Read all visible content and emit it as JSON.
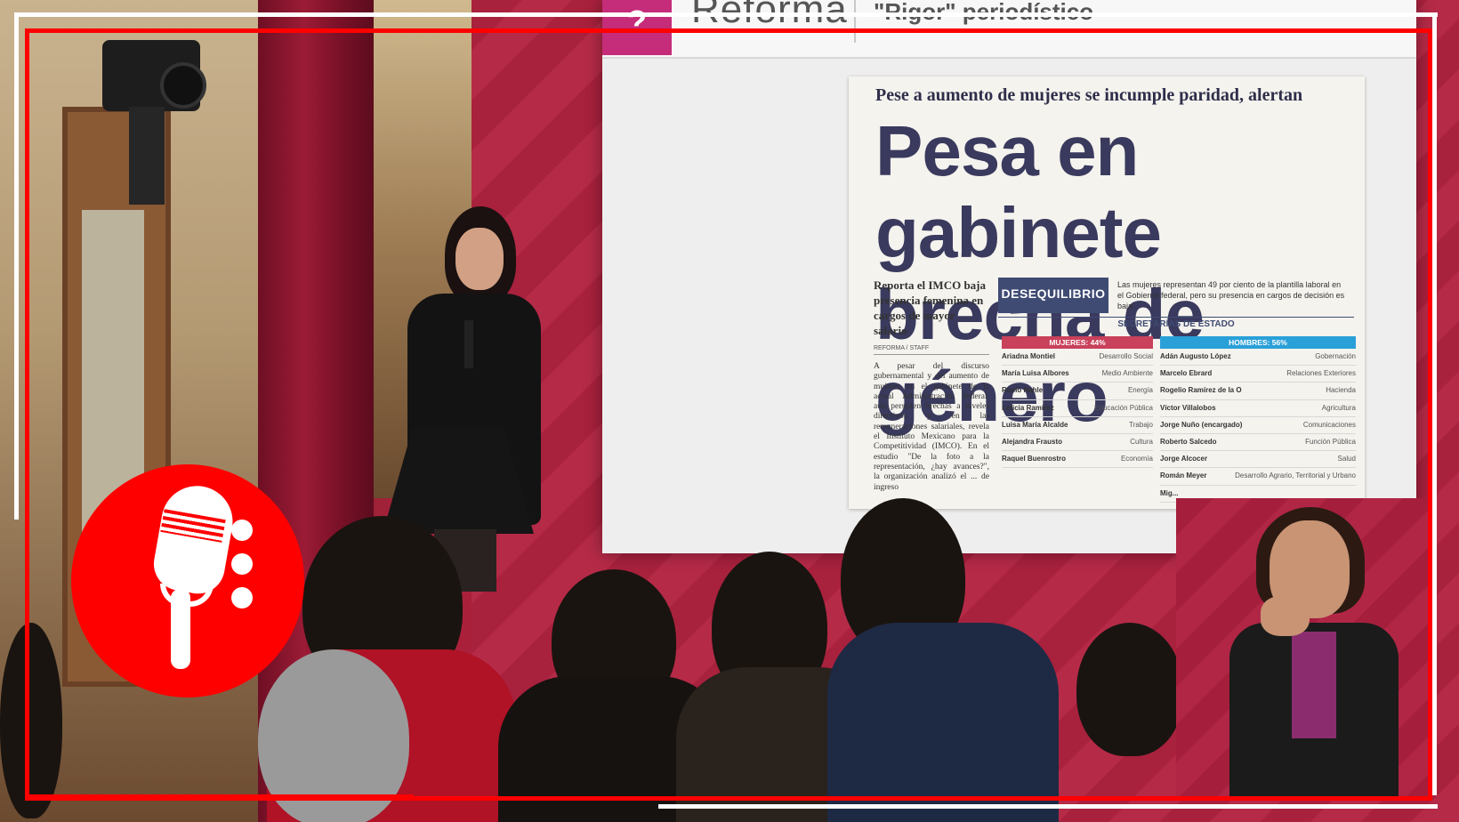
{
  "screen": {
    "source_label": "Reforma",
    "header_quote": "\"Rigor\" periodístico"
  },
  "article": {
    "kicker": "Pese a aumento de mujeres se incumple paridad, alertan",
    "headline_line1": "Pesa en gabinete",
    "headline_line2": "brecha de género",
    "summary": "Reporta el IMCO baja presencia femenina en cargos de mayor salario",
    "byline": "REFORMA / STAFF",
    "body": "A pesar del discurso gubernamental y del aumento de mujeres en el gabinete de la actual Administración federal, aún persisten brechas a niveles directivos y en las remuneraciones salariales, revela el Instituto Mexicano para la Competitividad (IMCO). En el estudio \"De la foto a la representación, ¿hay avances?\", la organización analizó el ... de ingreso"
  },
  "infographic": {
    "title": "DESEQUILIBRIO",
    "note": "Las mujeres representan 49 por ciento de la plantilla laboral en el Gobierno federal, pero su presencia en cargos de decisión es baja.",
    "section": "SECRETARÍAS DE ESTADO",
    "women_header": "MUJERES: 44%",
    "men_header": "HOMBRES: 56%",
    "women": [
      {
        "name": "Ariadna Montiel",
        "role": "Desarrollo Social"
      },
      {
        "name": "María Luisa Albores",
        "role": "Medio Ambiente"
      },
      {
        "name": "Rocío Nahle",
        "role": "Energía"
      },
      {
        "name": "Leticia Ramírez",
        "role": "Educación Pública"
      },
      {
        "name": "Luisa María Alcalde",
        "role": "Trabajo"
      },
      {
        "name": "Alejandra Frausto",
        "role": "Cultura"
      },
      {
        "name": "Raquel Buenrostro",
        "role": "Economía"
      }
    ],
    "men": [
      {
        "name": "Adán Augusto López",
        "role": "Gobernación"
      },
      {
        "name": "Marcelo Ebrard",
        "role": "Relaciones Exteriores"
      },
      {
        "name": "Rogelio Ramírez de la O",
        "role": "Hacienda"
      },
      {
        "name": "Víctor Villalobos",
        "role": "Agricultura"
      },
      {
        "name": "Jorge Nuño (encargado)",
        "role": "Comunicaciones"
      },
      {
        "name": "Roberto Salcedo",
        "role": "Función Pública"
      },
      {
        "name": "Jorge Alcocer",
        "role": "Salud"
      },
      {
        "name": "Román Meyer",
        "role": "Desarrollo Agrario, Territorial y Urbano"
      },
      {
        "name": "Mig...",
        "role": ""
      }
    ]
  },
  "colors": {
    "frame_red": "#ff0000",
    "tab_pink": "#c52c7a",
    "women_bar": "#c9415b",
    "men_bar": "#2aa0d8",
    "headline": "#3a3a5e"
  },
  "icons": {
    "logo": "microphone-icon",
    "screen_tab": "question-icon"
  }
}
